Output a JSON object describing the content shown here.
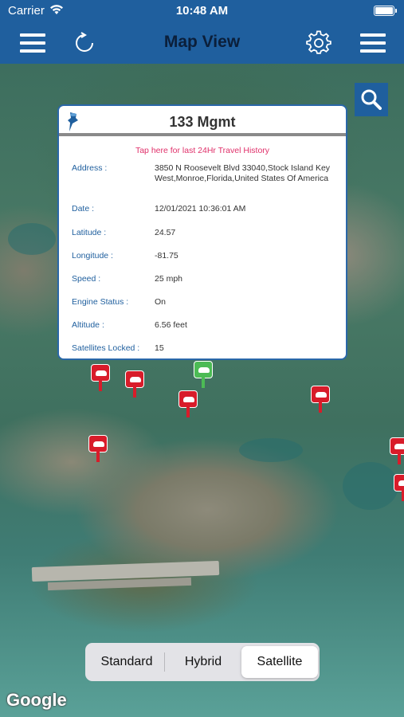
{
  "status_bar": {
    "carrier": "Carrier",
    "time": "10:48 AM"
  },
  "nav": {
    "title": "Map View",
    "left_icons": [
      "hamburger-menu-icon",
      "refresh-icon"
    ],
    "right_icons": [
      "gear-icon",
      "hamburger-menu-icon"
    ]
  },
  "popup": {
    "title": "133 Mgmt",
    "history_link": "Tap here for last 24Hr Travel History",
    "rows": [
      {
        "label": "Address :",
        "value": "3850 N Roosevelt Blvd 33040,Stock Island Key West,Monroe,Florida,United States Of America"
      },
      {
        "label": "Date :",
        "value": "12/01/2021 10:36:01 AM"
      },
      {
        "label": "Latitude :",
        "value": "24.57"
      },
      {
        "label": "Longitude :",
        "value": "-81.75"
      },
      {
        "label": "Speed :",
        "value": "25 mph"
      },
      {
        "label": "Engine Status :",
        "value": "On"
      },
      {
        "label": "Altitude :",
        "value": "6.56 feet"
      },
      {
        "label": "Satellites Locked :",
        "value": "15"
      }
    ]
  },
  "map_type": {
    "options": [
      "Standard",
      "Hybrid",
      "Satellite"
    ],
    "selected": "Satellite"
  },
  "map_attribution": "Google",
  "colors": {
    "nav_bar": "#1f5f9e",
    "link": "#e0306a",
    "label": "#1f5f9e",
    "marker": "#d81c2a",
    "marker_active": "#4cbb55"
  }
}
